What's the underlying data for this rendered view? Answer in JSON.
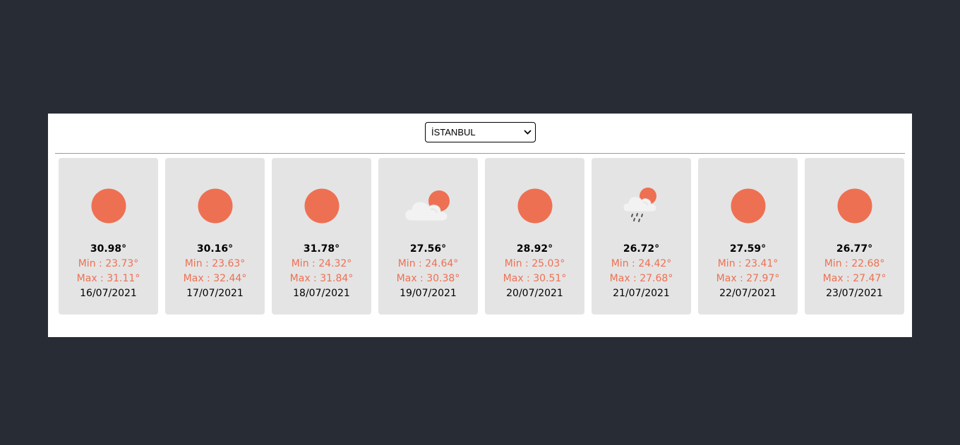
{
  "city_select": {
    "selected": "İSTANBUL"
  },
  "colors": {
    "accent": "#ee7052",
    "card_bg": "#e4e4e4",
    "page_bg": "#282c34"
  },
  "forecast": [
    {
      "icon": "sun-icon",
      "temp": "30.98°",
      "min_label": "Min :",
      "min": "23.73°",
      "max_label": "Max :",
      "max": "31.11°",
      "date": "16/07/2021"
    },
    {
      "icon": "sun-icon",
      "temp": "30.16°",
      "min_label": "Min :",
      "min": "23.63°",
      "max_label": "Max :",
      "max": "32.44°",
      "date": "17/07/2021"
    },
    {
      "icon": "sun-icon",
      "temp": "31.78°",
      "min_label": "Min :",
      "min": "24.32°",
      "max_label": "Max :",
      "max": "31.84°",
      "date": "18/07/2021"
    },
    {
      "icon": "partly-cloudy-icon",
      "temp": "27.56°",
      "min_label": "Min :",
      "min": "24.64°",
      "max_label": "Max :",
      "max": "30.38°",
      "date": "19/07/2021"
    },
    {
      "icon": "sun-icon",
      "temp": "28.92°",
      "min_label": "Min :",
      "min": "25.03°",
      "max_label": "Max :",
      "max": "30.51°",
      "date": "20/07/2021"
    },
    {
      "icon": "rain-icon",
      "temp": "26.72°",
      "min_label": "Min :",
      "min": "24.42°",
      "max_label": "Max :",
      "max": "27.68°",
      "date": "21/07/2021"
    },
    {
      "icon": "sun-icon",
      "temp": "27.59°",
      "min_label": "Min :",
      "min": "23.41°",
      "max_label": "Max :",
      "max": "27.97°",
      "date": "22/07/2021"
    },
    {
      "icon": "sun-icon",
      "temp": "26.77°",
      "min_label": "Min :",
      "min": "22.68°",
      "max_label": "Max :",
      "max": "27.47°",
      "date": "23/07/2021"
    }
  ]
}
